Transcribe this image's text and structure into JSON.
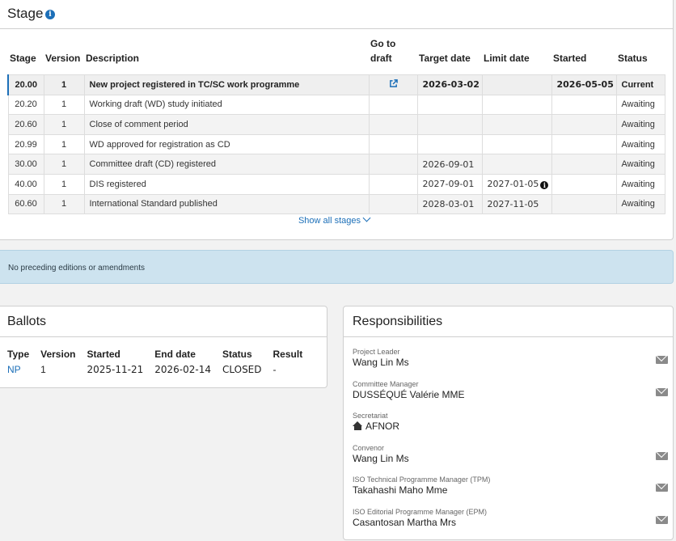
{
  "stage": {
    "title": "Stage",
    "columns": [
      "Stage",
      "Version",
      "Description",
      "Go to draft",
      "Target date",
      "Limit date",
      "Started",
      "Status"
    ],
    "rows": [
      {
        "stage": "20.00",
        "version": "1",
        "description": "New project registered in TC/SC work programme",
        "draft": "external-link-icon",
        "target": "2026-03-02",
        "limit": "",
        "started": "2026-05-05",
        "status": "Current"
      },
      {
        "stage": "20.20",
        "version": "1",
        "description": "Working draft (WD) study initiated",
        "draft": "",
        "target": "",
        "limit": "",
        "started": "",
        "status": "Awaiting"
      },
      {
        "stage": "20.60",
        "version": "1",
        "description": "Close of comment period",
        "draft": "",
        "target": "",
        "limit": "",
        "started": "",
        "status": "Awaiting"
      },
      {
        "stage": "20.99",
        "version": "1",
        "description": "WD approved for registration as CD",
        "draft": "",
        "target": "",
        "limit": "",
        "started": "",
        "status": "Awaiting"
      },
      {
        "stage": "30.00",
        "version": "1",
        "description": "Committee draft (CD) registered",
        "draft": "",
        "target": "2026-09-01",
        "limit": "",
        "started": "",
        "status": "Awaiting"
      },
      {
        "stage": "40.00",
        "version": "1",
        "description": "DIS registered",
        "draft": "",
        "target": "2027-09-01",
        "limit": "2027-01-05",
        "started": "",
        "status": "Awaiting"
      },
      {
        "stage": "60.60",
        "version": "1",
        "description": "International Standard published",
        "draft": "",
        "target": "2028-03-01",
        "limit": "2027-11-05",
        "started": "",
        "status": "Awaiting"
      }
    ],
    "show_all_label": "Show all stages"
  },
  "editions": {
    "text": "No preceding editions or amendments"
  },
  "ballots": {
    "title": "Ballots",
    "columns": [
      "Type",
      "Version",
      "Started",
      "End date",
      "Status",
      "Result"
    ],
    "rows": [
      {
        "type": "NP",
        "version": "1",
        "started": "2025-11-21",
        "end": "2026-02-14",
        "status": "CLOSED",
        "result": "-"
      }
    ]
  },
  "responsibilities": {
    "title": "Responsibilities",
    "items": [
      {
        "role": "Project Leader",
        "name": "Wang Lin Ms",
        "mail": true
      },
      {
        "role": "Committee Manager",
        "name": "DUSSÉQUÉ Valérie MME",
        "mail": true
      },
      {
        "role": "Secretariat",
        "name": "AFNOR",
        "mail": false,
        "icon": "home-icon"
      },
      {
        "role": "Convenor",
        "name": "Wang Lin Ms",
        "mail": true
      },
      {
        "role": "ISO Technical Programme Manager (TPM)",
        "name": "Takahashi Maho Mme",
        "mail": true
      },
      {
        "role": "ISO Editorial Programme Manager (EPM)",
        "name": "Casantosan Martha Mrs",
        "mail": true
      }
    ]
  },
  "colors": {
    "accent": "#1c6fb8",
    "info_bar": "#cde3ef",
    "panel_border": "#cfcfcf"
  }
}
